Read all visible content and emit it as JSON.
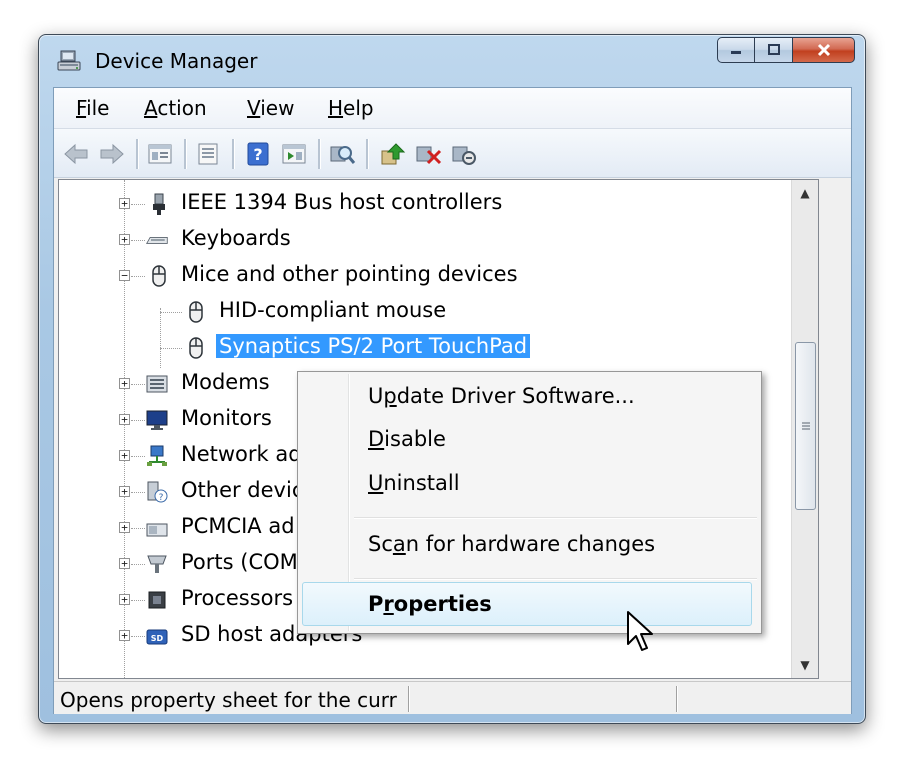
{
  "window": {
    "title": "Device Manager"
  },
  "caption_buttons": [
    "minimize",
    "maximize",
    "close"
  ],
  "menu": [
    {
      "label": "File",
      "mnemonic": "F"
    },
    {
      "label": "Action",
      "mnemonic": "A"
    },
    {
      "label": "View",
      "mnemonic": "V"
    },
    {
      "label": "Help",
      "mnemonic": "H"
    }
  ],
  "toolbar_icons": [
    "back-arrow-icon",
    "forward-arrow-icon",
    "show-hide-console-tree-icon",
    "properties-icon",
    "help-icon",
    "action-pane-icon",
    "scan-hardware-icon",
    "update-driver-icon",
    "uninstall-icon",
    "disable-icon"
  ],
  "tree": {
    "items": [
      {
        "label": "IEEE 1394 Bus host controllers",
        "icon": "usb-plug-icon",
        "expander": "+",
        "level": 0
      },
      {
        "label": "Keyboards",
        "icon": "keyboard-icon",
        "expander": "+",
        "level": 0
      },
      {
        "label": "Mice and other pointing devices",
        "icon": "mouse-icon",
        "expander": "−",
        "level": 0
      },
      {
        "label": "HID-compliant mouse",
        "icon": "mouse-icon",
        "level": 1
      },
      {
        "label": "Synaptics PS/2 Port TouchPad",
        "icon": "mouse-icon",
        "level": 1,
        "selected": true
      },
      {
        "label": "Modems",
        "icon": "modem-icon",
        "expander": "+",
        "level": 0
      },
      {
        "label": "Monitors",
        "icon": "monitor-icon",
        "expander": "+",
        "level": 0
      },
      {
        "label": "Network ad",
        "icon": "network-icon",
        "expander": "+",
        "level": 0
      },
      {
        "label": "Other devic",
        "icon": "unknown-device-icon",
        "expander": "+",
        "level": 0
      },
      {
        "label": "PCMCIA ad",
        "icon": "pcmcia-icon",
        "expander": "+",
        "level": 0
      },
      {
        "label": "Ports (COM",
        "icon": "port-icon",
        "expander": "+",
        "level": 0
      },
      {
        "label": "Processors",
        "icon": "processor-icon",
        "expander": "+",
        "level": 0
      },
      {
        "label": "SD host adapters",
        "icon": "sd-adapter-icon",
        "expander": "+",
        "level": 0
      }
    ]
  },
  "context_menu": {
    "items": [
      {
        "label": "Update Driver Software...",
        "pre": "U",
        "u": "p",
        "post": "date Driver Software..."
      },
      {
        "label": "Disable",
        "pre": "",
        "u": "D",
        "post": "isable"
      },
      {
        "label": "Uninstall",
        "pre": "",
        "u": "U",
        "post": "ninstall"
      },
      {
        "label": "Scan for hardware changes",
        "pre": "Sc",
        "u": "a",
        "post": "n for hardware changes"
      },
      {
        "label": "Properties",
        "pre": "P",
        "u": "r",
        "post": "operties",
        "bold": true,
        "hovered": true
      }
    ]
  },
  "status_bar": {
    "text": "Opens property sheet for the curr"
  }
}
